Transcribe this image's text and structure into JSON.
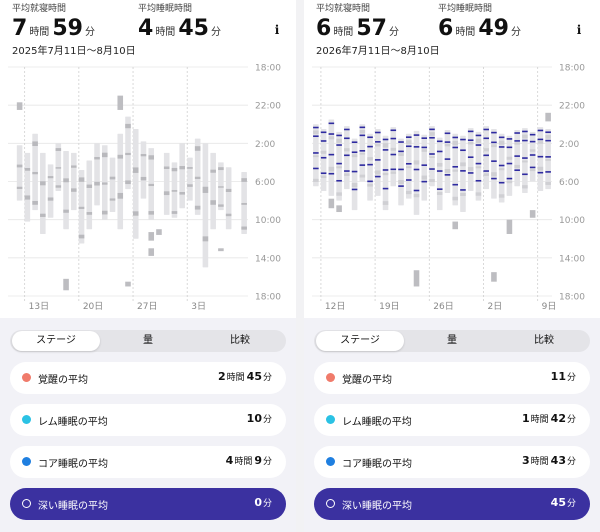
{
  "left": {
    "bed": {
      "label": "平均就寝時間",
      "h": "7",
      "hu": "時間",
      "m": "59",
      "mu": "分"
    },
    "sleep": {
      "label": "平均睡眠時間",
      "h": "4",
      "hu": "時間",
      "m": "45",
      "mu": "分"
    },
    "range": "2025年7月11日～8月10日",
    "info": "i",
    "ticks": [
      "18:00",
      "22:00",
      "2:00",
      "6:00",
      "10:00",
      "14:00",
      "18:00"
    ],
    "xlabels": [
      "13日",
      "20日",
      "27日",
      "3日"
    ],
    "tabs": [
      "ステージ",
      "量",
      "比較"
    ],
    "cards": [
      {
        "name": "覚醒の平均",
        "v": [
          [
            "2",
            "時間"
          ],
          [
            "45",
            "分"
          ]
        ],
        "color": "#f07b6b"
      },
      {
        "name": "レム睡眠の平均",
        "v": [
          [
            "10",
            "分"
          ]
        ],
        "color": "#2bc2e4"
      },
      {
        "name": "コア睡眠の平均",
        "v": [
          [
            "4",
            "時間"
          ],
          [
            "9",
            "分"
          ]
        ],
        "color": "#1f7fe0"
      },
      {
        "name": "深い睡眠の平均",
        "v": [
          [
            "0",
            "分"
          ]
        ],
        "color": "#3b31a0"
      }
    ]
  },
  "right": {
    "bed": {
      "label": "平均就寝時間",
      "h": "6",
      "hu": "時間",
      "m": "57",
      "mu": "分"
    },
    "sleep": {
      "label": "平均睡眠時間",
      "h": "6",
      "hu": "時間",
      "m": "49",
      "mu": "分"
    },
    "range": "2026年7月11日～8月10日",
    "info": "i",
    "ticks": [
      "18:00",
      "22:00",
      "2:00",
      "6:00",
      "10:00",
      "14:00",
      "18:00"
    ],
    "xlabels": [
      "12日",
      "19日",
      "26日",
      "2日",
      "9日"
    ],
    "tabs": [
      "ステージ",
      "量",
      "比較"
    ],
    "cards": [
      {
        "name": "覚醒の平均",
        "v": [
          [
            "11",
            "分"
          ]
        ],
        "color": "#f07b6b"
      },
      {
        "name": "レム睡眠の平均",
        "v": [
          [
            "1",
            "時間"
          ],
          [
            "42",
            "分"
          ]
        ],
        "color": "#2bc2e4"
      },
      {
        "name": "コア睡眠の平均",
        "v": [
          [
            "3",
            "時間"
          ],
          [
            "43",
            "分"
          ]
        ],
        "color": "#1f7fe0"
      },
      {
        "name": "深い睡眠の平均",
        "v": [
          [
            "45",
            "分"
          ]
        ],
        "color": "#3b31a0"
      }
    ]
  },
  "chart_data": [
    {
      "type": "bar",
      "x_start": "2025-07-11",
      "y_ticks": [
        "18:00",
        "22:00",
        "2:00",
        "6:00",
        "10:00",
        "14:00",
        "18:00"
      ],
      "x_tick_labels": [
        "13日",
        "20日",
        "27日",
        "3日"
      ],
      "bars": [
        [
          null,
          null
        ],
        [
          2.2,
          8.0
        ],
        [
          3.0,
          10.2
        ],
        [
          1.0,
          9.0
        ],
        [
          3.0,
          11.5
        ],
        [
          4.2,
          9.8
        ],
        [
          2.0,
          7.0
        ],
        [
          2.8,
          11.0
        ],
        [
          3.0,
          9.0
        ],
        [
          4.8,
          12.5
        ],
        [
          3.8,
          11.0
        ],
        [
          2.0,
          8.5
        ],
        [
          2.2,
          10.0
        ],
        [
          3.5,
          9.2
        ],
        [
          1.0,
          11.0
        ],
        [
          -0.8,
          6.8
        ],
        [
          0.5,
          12.0
        ],
        [
          1.8,
          7.8
        ],
        [
          2.5,
          10.0
        ],
        [
          null,
          null
        ],
        [
          3.0,
          9.5
        ],
        [
          4.0,
          9.8
        ],
        [
          2.0,
          8.8
        ],
        [
          3.5,
          8.0
        ],
        [
          1.5,
          9.5
        ],
        [
          2.0,
          15.0
        ],
        [
          3.0,
          11.0
        ],
        [
          4.0,
          9.0
        ],
        [
          4.5,
          11.0
        ],
        [
          null,
          null
        ],
        [
          5.0,
          11.5
        ]
      ],
      "extra_marks": [
        [
          1,
          -2.3,
          -1.5
        ],
        [
          7,
          16.2,
          17.4
        ],
        [
          14,
          -3.0,
          -1.5
        ],
        [
          15,
          16.5,
          17.0
        ],
        [
          18,
          11.3,
          12.2
        ],
        [
          18,
          13.0,
          13.8
        ],
        [
          19,
          11.0,
          11.6
        ],
        [
          27,
          13.0,
          13.3
        ]
      ]
    },
    {
      "type": "bar",
      "x_start": "2026-07-11",
      "y_ticks": [
        "18:00",
        "22:00",
        "2:00",
        "6:00",
        "10:00",
        "14:00",
        "18:00"
      ],
      "x_tick_labels": [
        "12日",
        "19日",
        "26日",
        "2日",
        "9日"
      ],
      "bars": [
        [
          0.0,
          6.5
        ],
        [
          0.5,
          7.0
        ],
        [
          -0.5,
          7.5
        ],
        [
          0.8,
          8.0
        ],
        [
          0.2,
          6.8
        ],
        [
          1.5,
          9.0
        ],
        [
          0.0,
          6.0
        ],
        [
          1.0,
          8.0
        ],
        [
          0.5,
          7.5
        ],
        [
          1.2,
          9.0
        ],
        [
          0.3,
          6.5
        ],
        [
          1.5,
          8.5
        ],
        [
          1.0,
          7.8
        ],
        [
          0.7,
          9.5
        ],
        [
          1.1,
          8.0
        ],
        [
          0.2,
          6.5
        ],
        [
          1.4,
          9.0
        ],
        [
          0.6,
          7.2
        ],
        [
          1.0,
          8.5
        ],
        [
          1.2,
          9.2
        ],
        [
          0.4,
          7.0
        ],
        [
          0.8,
          8.0
        ],
        [
          0.2,
          6.8
        ],
        [
          0.5,
          7.8
        ],
        [
          1.0,
          8.2
        ],
        [
          1.2,
          7.5
        ],
        [
          0.6,
          6.5
        ],
        [
          0.4,
          7.2
        ],
        [
          0.8,
          6.0
        ],
        [
          0.3,
          7.0
        ],
        [
          0.5,
          6.8
        ]
      ],
      "extra_marks": [
        [
          2,
          7.8,
          8.8
        ],
        [
          3,
          8.5,
          9.2
        ],
        [
          13,
          15.3,
          17.0
        ],
        [
          18,
          10.2,
          11.0
        ],
        [
          23,
          15.5,
          16.5
        ],
        [
          25,
          10.0,
          11.5
        ],
        [
          28,
          9.0,
          9.8
        ],
        [
          30,
          -1.2,
          -0.3
        ]
      ]
    }
  ]
}
